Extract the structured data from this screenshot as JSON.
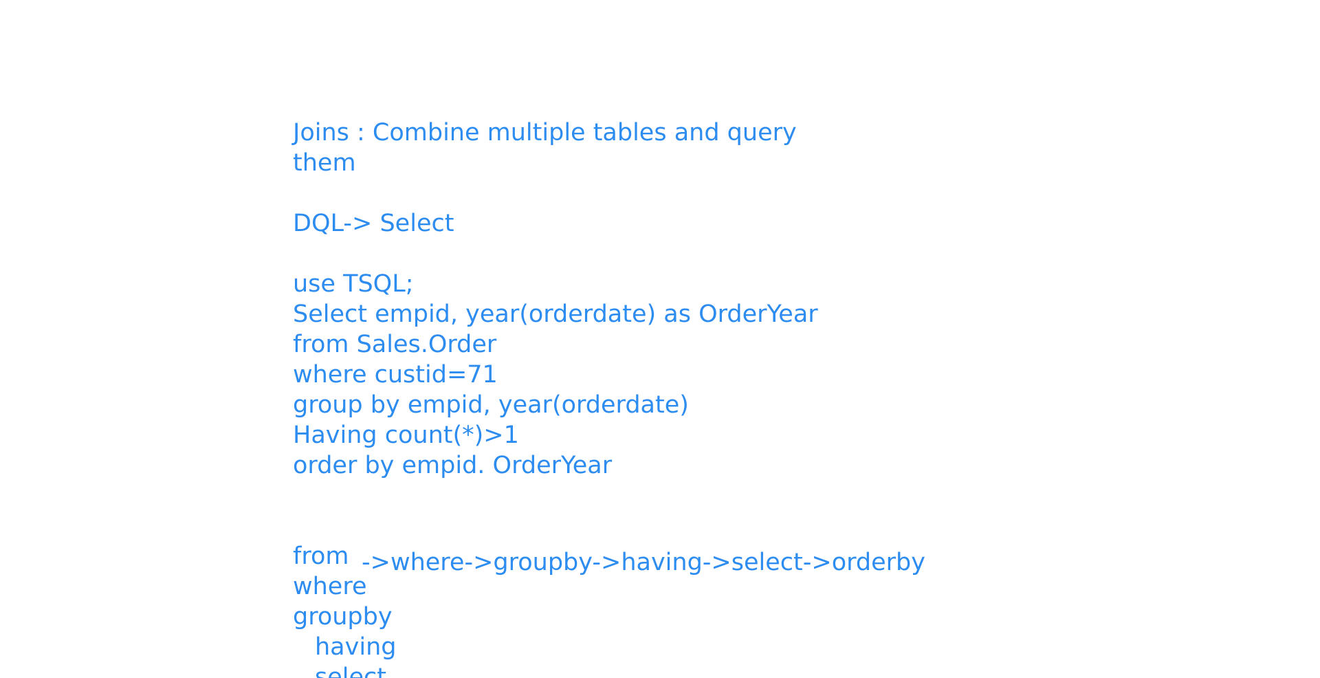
{
  "notes": {
    "joins_line1": "Joins : Combine multiple tables and query",
    "joins_line2": "them",
    "dql_line": "DQL-> Select",
    "query": {
      "use": "use TSQL;",
      "select": "Select empid, year(orderdate) as OrderYear",
      "from": "from Sales.Order",
      "where": "where custid=71",
      "group_by": "group by empid, year(orderdate)",
      "having": "Having count(*)>1",
      "order_by": "order by empid. OrderYear"
    },
    "order_of_execution": {
      "from": "from",
      "chain": "->where->groupby->having->select->orderby",
      "where": "where",
      "groupby": "groupby",
      "having": "having",
      "select": "select"
    }
  },
  "colors": {
    "ink": "#2d8cf0",
    "background": "#ffffff"
  }
}
